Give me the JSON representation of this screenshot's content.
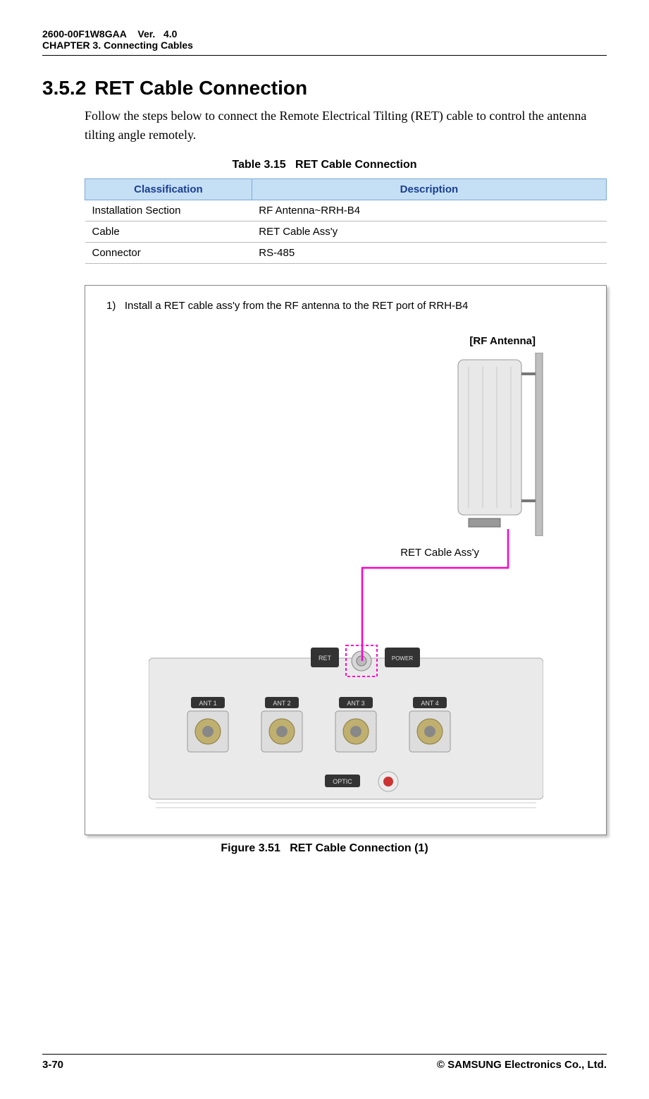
{
  "header": {
    "doc_id": "2600-00F1W8GAA",
    "ver_label": "Ver.",
    "ver_value": "4.0",
    "chapter": "CHAPTER 3. Connecting Cables"
  },
  "section": {
    "number": "3.5.2",
    "title": "RET Cable Connection",
    "paragraph": "Follow the steps below to connect the Remote Electrical Tilting (RET) cable to control the antenna tilting angle remotely."
  },
  "table": {
    "caption_label": "Table 3.15",
    "caption_title": "RET Cable Connection",
    "columns": [
      "Classification",
      "Description"
    ],
    "rows": [
      {
        "classification": "Installation Section",
        "description": "RF Antenna~RRH-B4"
      },
      {
        "classification": "Cable",
        "description": "RET Cable Ass'y"
      },
      {
        "classification": "Connector",
        "description": "RS-485"
      }
    ]
  },
  "figure": {
    "step_number": "1)",
    "step_text": "Install a RET cable ass'y from the RF antenna to the RET port of RRH-B4",
    "antenna_label": "[RF Antenna]",
    "cable_label": "RET Cable Ass'y",
    "device_ports": {
      "ret": "RET",
      "power": "POWER",
      "ants": [
        "ANT 1",
        "ANT 2",
        "ANT 3",
        "ANT 4"
      ],
      "optic": "OPTIC"
    },
    "caption_label": "Figure 3.51",
    "caption_title": "RET Cable Connection (1)"
  },
  "footer": {
    "page": "3-70",
    "copyright": "© SAMSUNG Electronics Co., Ltd."
  }
}
